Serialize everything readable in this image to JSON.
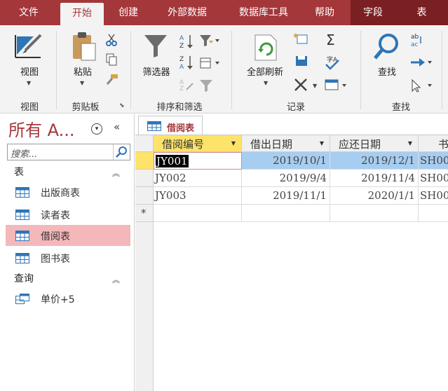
{
  "tabs": [
    "文件",
    "开始",
    "创建",
    "外部数据",
    "数据库工具",
    "帮助",
    "字段",
    "表"
  ],
  "ribbon": {
    "groups": {
      "view": "视图",
      "clipboard": "剪贴板",
      "sort_filter": "排序和筛选",
      "records": "记录",
      "find": "查找"
    },
    "buttons": {
      "view": "视图",
      "paste": "粘贴",
      "filter": "筛选器",
      "refresh_all": "全部刷新",
      "find": "查找"
    }
  },
  "nav": {
    "title": "所有 A...",
    "search_placeholder": "搜索...",
    "sections": [
      {
        "label": "表",
        "items": [
          "出版商表",
          "读者表",
          "借阅表",
          "图书表"
        ]
      },
      {
        "label": "查询",
        "items": [
          "单价+5"
        ]
      }
    ],
    "selected_item": "借阅表"
  },
  "document": {
    "tab_label": "借阅表",
    "columns": [
      "借阅编号",
      "借出日期",
      "应还日期",
      "书"
    ],
    "rows": [
      [
        "JY001",
        "2019/10/1",
        "2019/12/1",
        "SH00"
      ],
      [
        "JY002",
        "2019/9/4",
        "2019/11/4",
        "SH00"
      ],
      [
        "JY003",
        "2019/11/1",
        "2020/1/1",
        "SH00"
      ]
    ],
    "new_record_marker": "*"
  },
  "colors": {
    "accent": "#a4373a",
    "selected_nav": "#f4b8bb",
    "selected_header": "#fde36a",
    "selected_row": "#a7cdf0"
  }
}
